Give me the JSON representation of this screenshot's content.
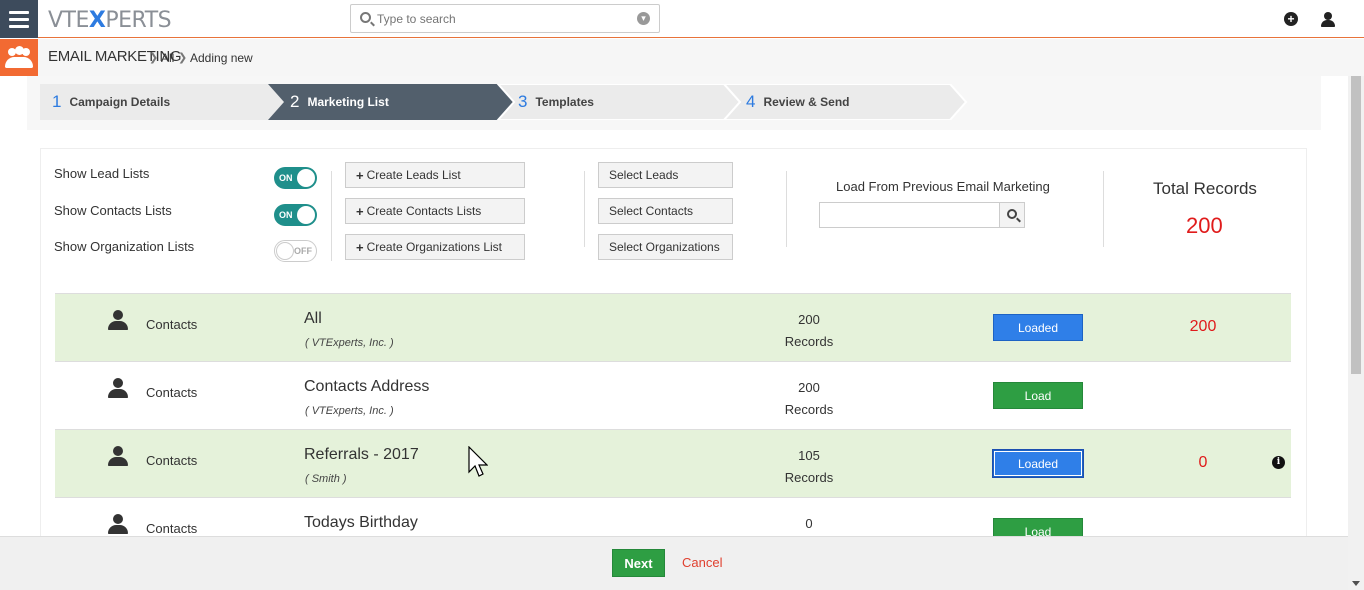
{
  "topbar": {
    "logo_left": "VTE",
    "logo_x": "X",
    "logo_right": "PERTS",
    "search_placeholder": "Type to search"
  },
  "breadcrumb": {
    "module": "EMAIL MARKETING",
    "all": "All",
    "current": "Adding new"
  },
  "wizard": {
    "steps": [
      {
        "num": "1",
        "label": "Campaign Details"
      },
      {
        "num": "2",
        "label": "Marketing List",
        "active": true
      },
      {
        "num": "3",
        "label": "Templates"
      },
      {
        "num": "4",
        "label": "Review & Send"
      }
    ]
  },
  "filters": {
    "lead": {
      "label": "Show Lead Lists",
      "state": "ON"
    },
    "contacts": {
      "label": "Show Contacts Lists",
      "state": "ON"
    },
    "orgs": {
      "label": "Show Organization Lists",
      "state": "OFF"
    }
  },
  "create_buttons": {
    "leads": "Create Leads List",
    "contacts": "Create Contacts Lists",
    "orgs": "Create Organizations List"
  },
  "select_buttons": {
    "leads": "Select Leads",
    "contacts": "Select Contacts",
    "orgs": "Select Organizations"
  },
  "load_previous": {
    "label": "Load From Previous Email Marketing"
  },
  "totals": {
    "label": "Total Records",
    "value": "200"
  },
  "rows": [
    {
      "module": "Contacts",
      "name": "All",
      "owner": "( VTExperts, Inc. )",
      "count": "200",
      "unit": "Records",
      "button": "Loaded",
      "loaded_count": "200"
    },
    {
      "module": "Contacts",
      "name": "Contacts Address",
      "owner": "( VTExperts, Inc. )",
      "count": "200",
      "unit": "Records",
      "button": "Load",
      "loaded_count": ""
    },
    {
      "module": "Contacts",
      "name": "Referrals - 2017",
      "owner": "( Smith )",
      "count": "105",
      "unit": "Records",
      "button": "Loaded",
      "loaded_count": "0"
    },
    {
      "module": "Contacts",
      "name": "Todays Birthday",
      "owner": "",
      "count": "0",
      "unit": "",
      "button": "Load",
      "loaded_count": ""
    }
  ],
  "footer": {
    "next": "Next",
    "cancel": "Cancel"
  },
  "colors": {
    "accent": "#e8733a",
    "loaded_bg": "#e5f2da",
    "blue": "#2f7fe8",
    "green": "#2e9e43",
    "red": "#e01b1b",
    "toggle_on": "#1f8f8b"
  }
}
